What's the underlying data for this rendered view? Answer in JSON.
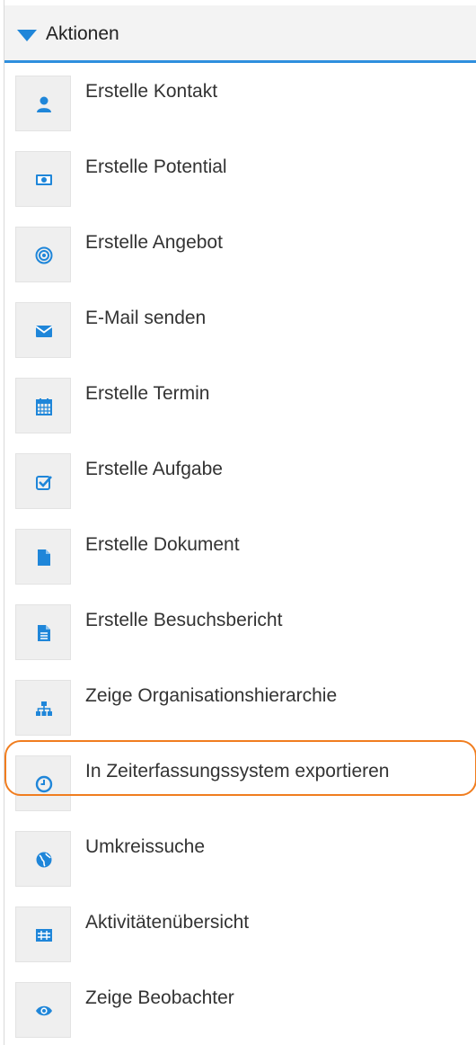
{
  "header": {
    "title": "Aktionen"
  },
  "accent_color": "#1f86d9",
  "highlight_color": "#f07d1f",
  "actions": [
    {
      "label": "Erstelle Kontakt",
      "icon": "user-icon"
    },
    {
      "label": "Erstelle Potential",
      "icon": "money-icon"
    },
    {
      "label": "Erstelle Angebot",
      "icon": "target-icon"
    },
    {
      "label": "E-Mail senden",
      "icon": "envelope-icon"
    },
    {
      "label": "Erstelle Termin",
      "icon": "calendar-icon"
    },
    {
      "label": "Erstelle Aufgabe",
      "icon": "checkbox-icon"
    },
    {
      "label": "Erstelle Dokument",
      "icon": "file-icon"
    },
    {
      "label": "Erstelle Besuchsbericht",
      "icon": "file-text-icon"
    },
    {
      "label": "Zeige Organisationshierarchie",
      "icon": "sitemap-icon"
    },
    {
      "label": "In Zeiterfassungssystem exportieren",
      "icon": "clock-icon",
      "highlighted": true
    },
    {
      "label": "Umkreissuche",
      "icon": "globe-icon"
    },
    {
      "label": "Aktivitätenübersicht",
      "icon": "table-icon"
    },
    {
      "label": "Zeige Beobachter",
      "icon": "eye-icon"
    }
  ]
}
